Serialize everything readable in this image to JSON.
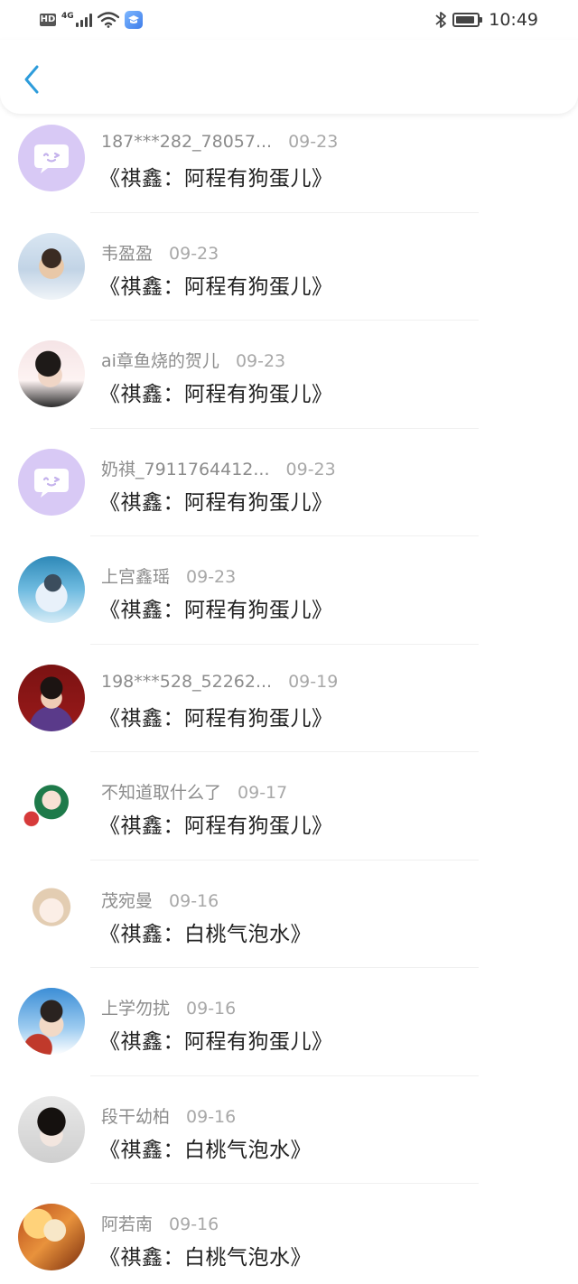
{
  "status_bar": {
    "hd": "HD",
    "network": "4G",
    "time": "10:49",
    "battery_level": 0.9,
    "icons": [
      "hd-badge",
      "signal-icon",
      "wifi-icon",
      "app-notification-icon",
      "bluetooth-icon",
      "battery-icon"
    ]
  },
  "header": {
    "back_icon": "chevron-left-icon",
    "accent": "#2d9cdb"
  },
  "items": [
    {
      "name": "187***282_78057...",
      "date": "09-23",
      "title": "《祺鑫：阿程有狗蛋儿》",
      "avatar": "default"
    },
    {
      "name": "韦盈盈",
      "date": "09-23",
      "title": "《祺鑫：阿程有狗蛋儿》",
      "avatar": "photo"
    },
    {
      "name": "ai章鱼烧的贺儿",
      "date": "09-23",
      "title": "《祺鑫：阿程有狗蛋儿》",
      "avatar": "photo"
    },
    {
      "name": "奶祺_7911764412...",
      "date": "09-23",
      "title": "《祺鑫：阿程有狗蛋儿》",
      "avatar": "default"
    },
    {
      "name": "上宫鑫瑶",
      "date": "09-23",
      "title": "《祺鑫：阿程有狗蛋儿》",
      "avatar": "photo"
    },
    {
      "name": "198***528_52262...",
      "date": "09-19",
      "title": "《祺鑫：阿程有狗蛋儿》",
      "avatar": "photo"
    },
    {
      "name": "不知道取什么了",
      "date": "09-17",
      "title": "《祺鑫：阿程有狗蛋儿》",
      "avatar": "photo"
    },
    {
      "name": "茂宛曼",
      "date": "09-16",
      "title": "《祺鑫：白桃气泡水》",
      "avatar": "photo"
    },
    {
      "name": "上学勿扰",
      "date": "09-16",
      "title": "《祺鑫：阿程有狗蛋儿》",
      "avatar": "photo"
    },
    {
      "name": "段干幼柏",
      "date": "09-16",
      "title": "《祺鑫：白桃气泡水》",
      "avatar": "photo"
    },
    {
      "name": "阿若南",
      "date": "09-16",
      "title": "《祺鑫：白桃气泡水》",
      "avatar": "photo"
    }
  ]
}
